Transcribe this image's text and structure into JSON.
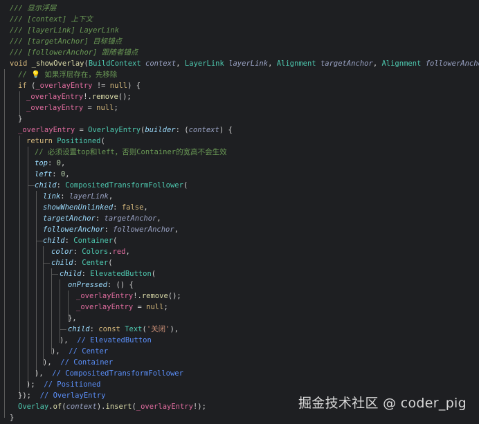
{
  "editor": {
    "language": "Dart",
    "background": "#1e1f22"
  },
  "code": {
    "l01": "/// 显示浮层",
    "l02": "/// [context] 上下文",
    "l03": "/// [layerLink] LayerLink",
    "l04": "/// [targetAnchor] 目标锚点",
    "l05": "/// [followerAnchor] 跟随者锚点",
    "l06_kw": "void",
    "l06_fn": "_showOverlay",
    "l06_a": "(",
    "l06_t1": "BuildContext",
    "l06_p1": "context",
    "l06_t2": "LayerLink",
    "l06_p2": "layerLink",
    "l06_t3": "Alignment",
    "l06_p3": "targetAnchor",
    "l06_t4": "Alignment",
    "l06_p4": "followerAnchor",
    "l06_end": ") {",
    "l07_c": "// 💡 如果浮层存在，先移除",
    "l08_kw": "if",
    "l08_v": "_overlayEntry",
    "l08_op": " != ",
    "l08_null": "null",
    "l08_end": ") {",
    "l09_v": "_overlayEntry",
    "l09_fn": "remove",
    "l10_v": "_overlayEntry",
    "l10_null": "null",
    "l11": "}",
    "l12_v": "_overlayEntry",
    "l12_ty": "OverlayEntry",
    "l12_pr": "builder",
    "l12_pm": "context",
    "l13_kw": "return",
    "l13_ty": "Positioned",
    "l14_c": "// 必须设置top和left，否则Container的宽高不会生效",
    "l15_pr": "top",
    "l15_nu": "0",
    "l16_pr": "left",
    "l16_nu": "0",
    "l17_pr": "child",
    "l17_ty": "CompositedTransformFollower",
    "l18_pr": "link",
    "l18_pm": "layerLink",
    "l19_pr": "showWhenUnlinked",
    "l19_kw": "false",
    "l20_pr": "targetAnchor",
    "l20_pm": "targetAnchor",
    "l21_pr": "followerAnchor",
    "l21_pm": "followerAnchor",
    "l22_pr": "child",
    "l22_ty": "Container",
    "l23_pr": "color",
    "l23_ty": "Colors",
    "l23_v": "red",
    "l24_pr": "child",
    "l24_ty": "Center",
    "l25_pr": "child",
    "l25_ty": "ElevatedButton",
    "l26_pr": "onPressed",
    "l27_v": "_overlayEntry",
    "l27_fn": "remove",
    "l28_v": "_overlayEntry",
    "l28_null": "null",
    "l29": "},",
    "l30_pr": "child",
    "l30_kw": "const",
    "l30_ty": "Text",
    "l30_st": "'关闭'",
    "l31_c": "// ElevatedButton",
    "l32_c": "// Center",
    "l33_c": "// Container",
    "l34_c": "// CompositedTransformFollower",
    "l35_c": "// Positioned",
    "l36_c": "// OverlayEntry",
    "l37_ty": "Overlay",
    "l37_fn1": "of",
    "l37_pm": "context",
    "l37_fn2": "insert",
    "l37_v": "_overlayEntry",
    "l38": "}"
  },
  "watermark": "掘金技术社区 @ coder_pig"
}
